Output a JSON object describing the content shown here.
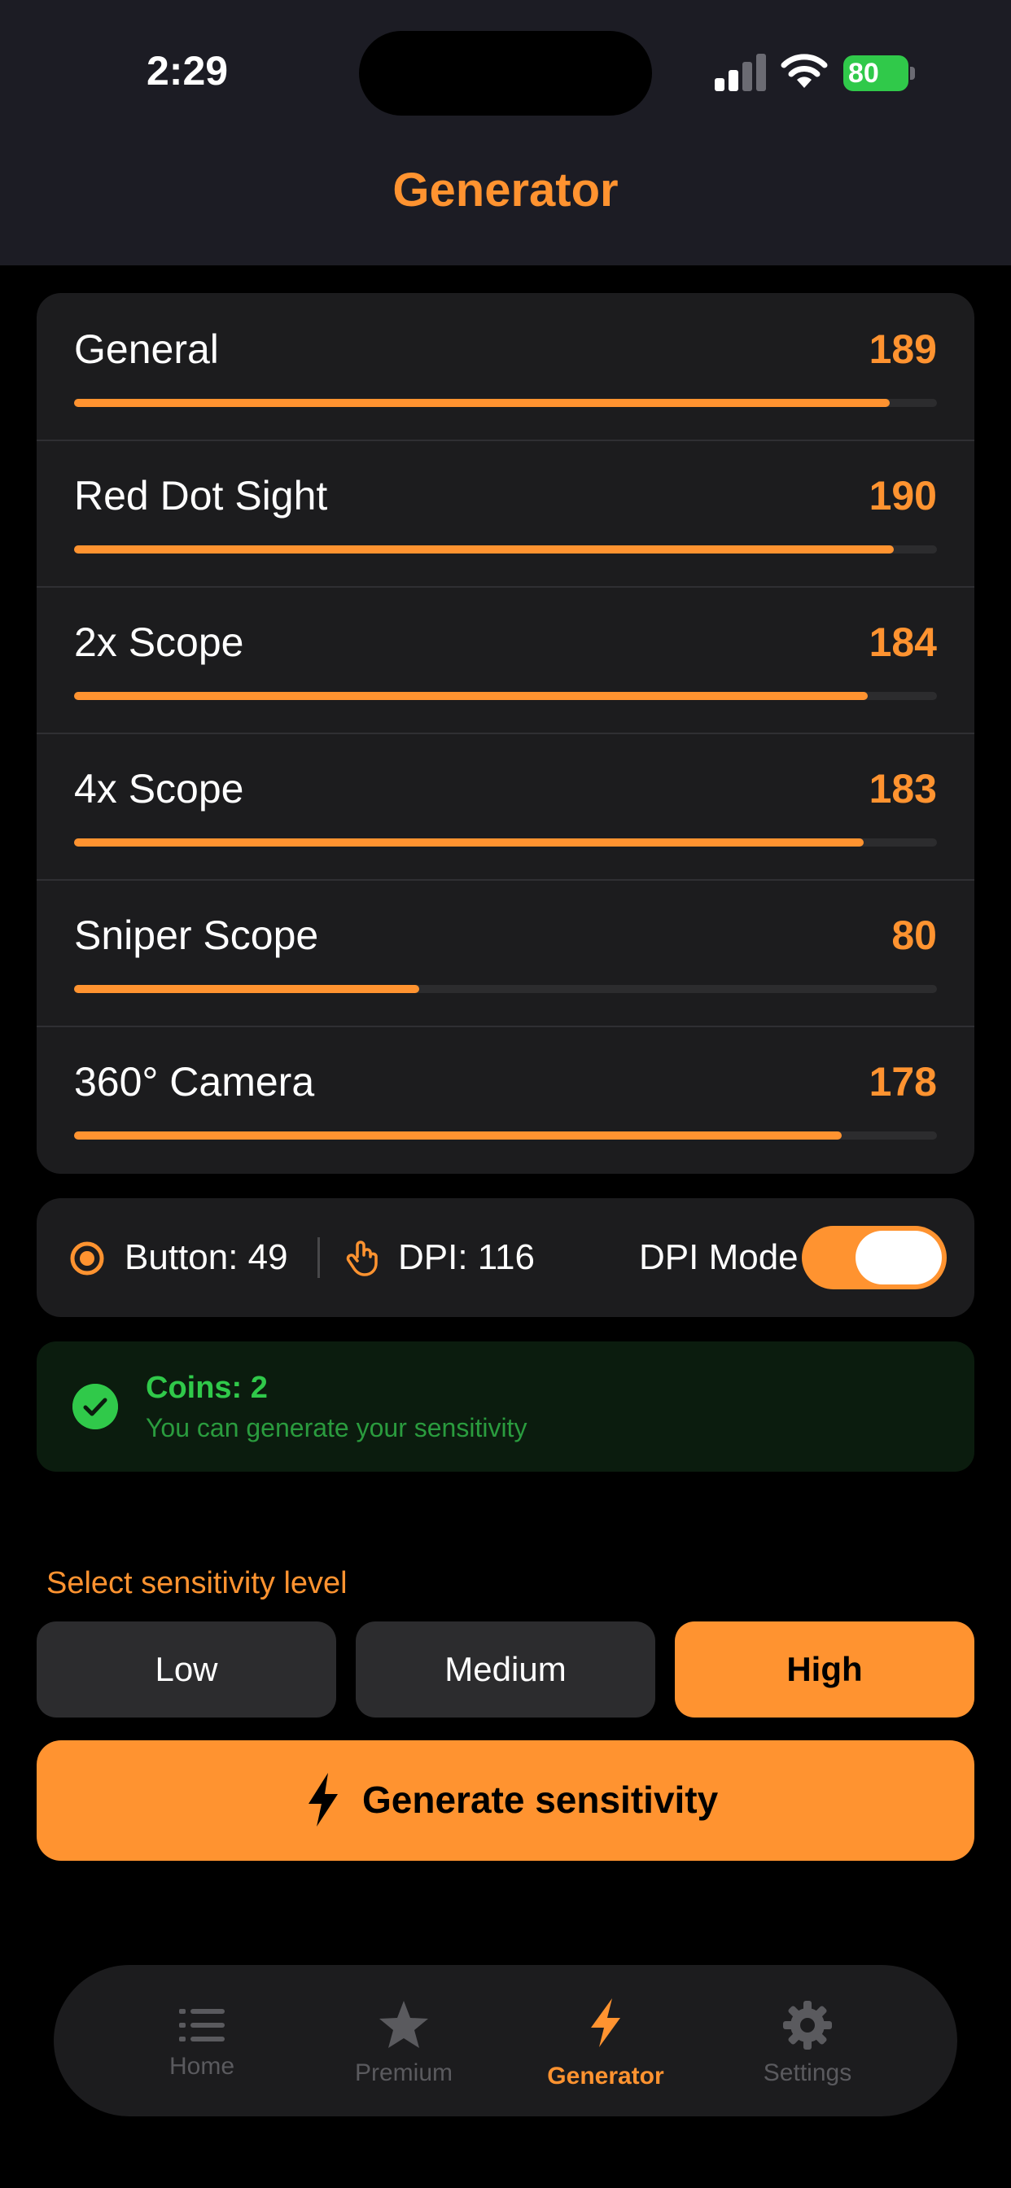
{
  "status_bar": {
    "time": "2:29",
    "battery": "80"
  },
  "header": {
    "title": "Generator"
  },
  "sensitivity": [
    {
      "label": "General",
      "value": "189",
      "level": 0.945
    },
    {
      "label": "Red Dot Sight",
      "value": "190",
      "level": 0.95
    },
    {
      "label": "2x Scope",
      "value": "184",
      "level": 0.92
    },
    {
      "label": "4x Scope",
      "value": "183",
      "level": 0.915
    },
    {
      "label": "Sniper Scope",
      "value": "80",
      "level": 0.4
    },
    {
      "label": "360° Camera",
      "value": "178",
      "level": 0.89
    }
  ],
  "info": {
    "button_text": "Button: 49",
    "dpi_text": "DPI: 116",
    "dpi_mode_label": "DPI Mode",
    "dpi_mode_on": true
  },
  "coins": {
    "title": "Coins: 2",
    "subtitle": "You can generate your sensitivity"
  },
  "level_select": {
    "label": "Select sensitivity level",
    "options": [
      "Low",
      "Medium",
      "High"
    ],
    "selected": "High"
  },
  "generate_button": {
    "label": "Generate sensitivity"
  },
  "tabbar": {
    "items": [
      {
        "label": "Home",
        "icon": "list-icon"
      },
      {
        "label": "Premium",
        "icon": "star-icon"
      },
      {
        "label": "Generator",
        "icon": "bolt-icon"
      },
      {
        "label": "Settings",
        "icon": "gear-icon"
      }
    ],
    "active": "Generator"
  },
  "colors": {
    "accent": "#ff9330",
    "success": "#30c94a",
    "card": "#1c1c1e",
    "header": "#1c1c24"
  }
}
